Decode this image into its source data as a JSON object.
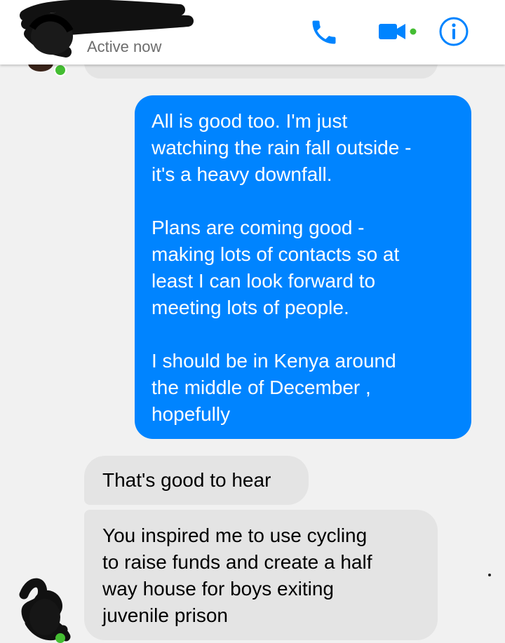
{
  "header": {
    "status": "Active now",
    "icons": {
      "call": "phone-icon",
      "video": "video-camera-icon",
      "info": "info-icon"
    },
    "accent_color": "#0084ff",
    "online_color": "#44bd32"
  },
  "messages": {
    "sent": {
      "paragraphs": [
        "All is good too. I'm just\nwatching the rain fall outside -\nit's a heavy downfall.",
        "Plans are coming good  -\nmaking lots of contacts so at\nleast I can look forward to\nmeeting lots of people.",
        "I should be in Kenya around\nthe middle of December  ,\nhopefully"
      ],
      "color": "#0084ff"
    },
    "received": [
      "That's good to hear",
      "You inspired me to use cycling\nto raise funds and create a half\nway house for boys exiting\njuvenile prison"
    ],
    "received_color": "#e4e4e4"
  }
}
